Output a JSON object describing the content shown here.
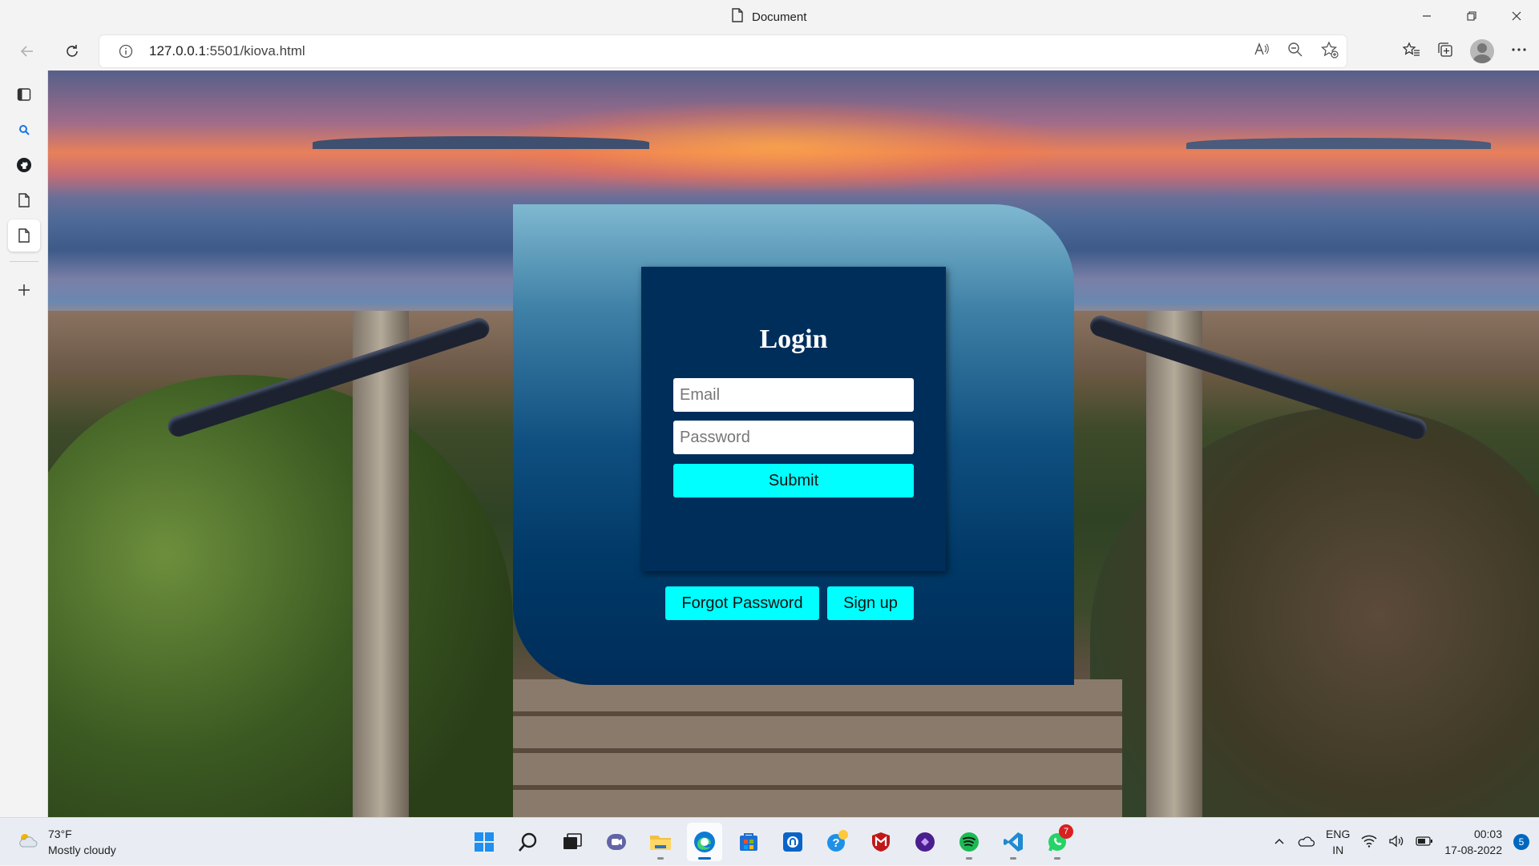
{
  "browser": {
    "tab_title": "Document",
    "url_host": "127.0.0.1",
    "url_rest": ":5501/kiova.html"
  },
  "page": {
    "login_title": "Login",
    "email_placeholder": "Email",
    "password_placeholder": "Password",
    "submit_label": "Submit",
    "forgot_label": "Forgot Password",
    "signup_label": "Sign up"
  },
  "taskbar": {
    "weather_temp": "73°F",
    "weather_desc": "Mostly cloudy",
    "lang_1": "ENG",
    "lang_2": "IN",
    "time": "00:03",
    "date": "17-08-2022",
    "notif_count": "5",
    "whatsapp_badge": "7"
  },
  "colors": {
    "accent_cyan": "#00ffff",
    "login_box": "#002e5b",
    "card_top": "#7fb8d0",
    "card_bottom": "#002d5a"
  }
}
